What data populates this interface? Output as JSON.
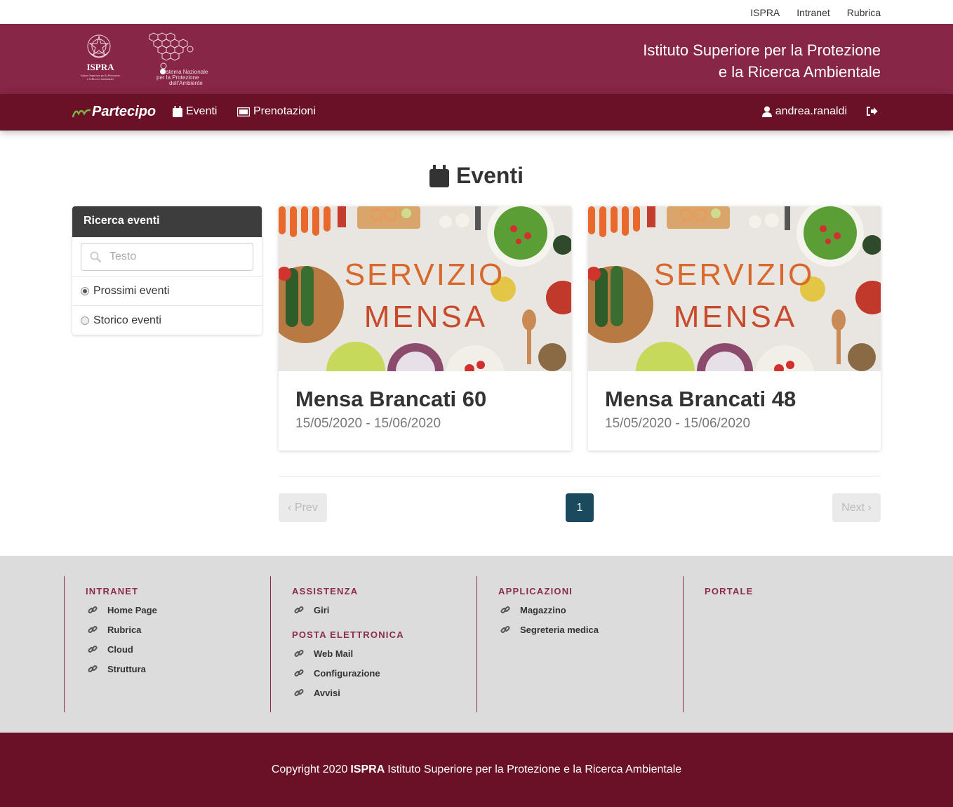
{
  "top_links": [
    "ISPRA",
    "Intranet",
    "Rubrica"
  ],
  "brand": {
    "title_line1": "Istituto Superiore per la Protezione",
    "title_line2": "e la Ricerca Ambientale",
    "ispra_logo_text": "ISPRA",
    "ispra_logo_subtext": "Istituto Superiore per la Protezione e la Ricerca Ambientale",
    "snpa_logo_text": "Sistema Nazionale per la Protezione dell'Ambiente",
    "color": "#872646"
  },
  "navbar": {
    "app_name": "Partecipo",
    "items": [
      "Eventi",
      "Prenotazioni"
    ],
    "user": "andrea.ranaldi",
    "color": "#6a1027"
  },
  "page": {
    "title": "Eventi"
  },
  "sidebar": {
    "header": "Ricerca eventi",
    "search_placeholder": "Testo",
    "options": [
      {
        "label": "Prossimi eventi",
        "selected": true
      },
      {
        "label": "Storico eventi",
        "selected": false
      }
    ]
  },
  "events": [
    {
      "name": "Mensa Brancati 60",
      "dates": "15/05/2020 - 15/06/2020",
      "image_text_1": "SERVIZIO",
      "image_text_2": "MENSA"
    },
    {
      "name": "Mensa Brancati 48",
      "dates": "15/05/2020 - 15/06/2020",
      "image_text_1": "SERVIZIO",
      "image_text_2": "MENSA"
    }
  ],
  "pagination": {
    "prev": "‹ Prev",
    "current": "1",
    "next": "Next ›",
    "active_color": "#1b4a5e"
  },
  "footer": {
    "columns": [
      {
        "sections": [
          {
            "title": "INTRANET",
            "links": [
              "Home Page",
              "Rubrica",
              "Cloud",
              "Struttura"
            ]
          }
        ]
      },
      {
        "sections": [
          {
            "title": "ASSISTENZA",
            "links": [
              "Giri"
            ]
          },
          {
            "title": "POSTA ELETTRONICA",
            "links": [
              "Web Mail",
              "Configurazione",
              "Avvisi"
            ]
          }
        ]
      },
      {
        "sections": [
          {
            "title": "APPLICAZIONI",
            "links": [
              "Magazzino",
              "Segreteria medica"
            ]
          }
        ]
      },
      {
        "sections": [
          {
            "title": "PORTALE",
            "links": []
          }
        ]
      }
    ],
    "copyright_prefix": "Copyright 2020",
    "copyright_org": "ISPRA",
    "copyright_suffix": "Istituto Superiore per la Protezione e la Ricerca Ambientale"
  }
}
